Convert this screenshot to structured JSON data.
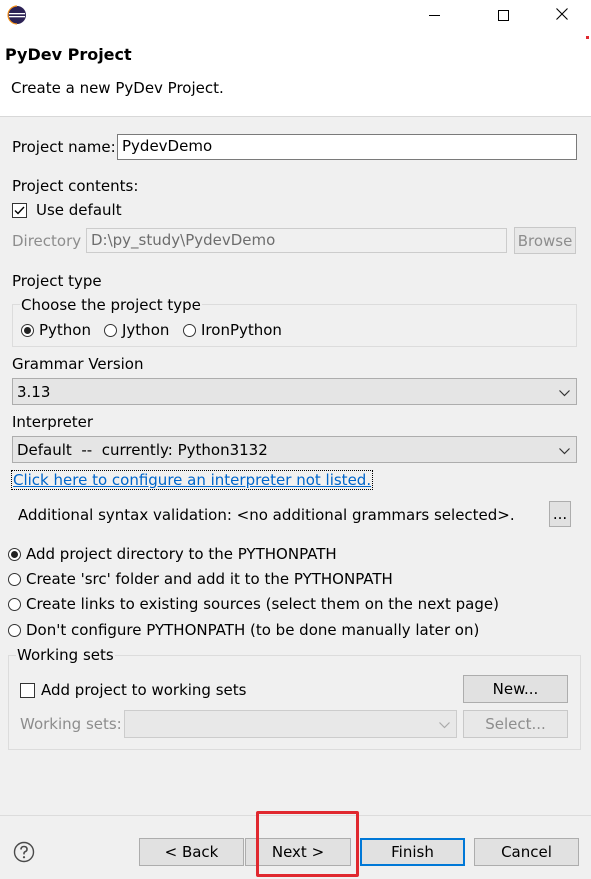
{
  "window": {
    "title": "",
    "icon": "eclipse-icon",
    "controls": [
      "minimize-icon",
      "maximize-icon",
      "close-icon"
    ]
  },
  "header": {
    "title": "PyDev Project",
    "description": "Create a new PyDev Project."
  },
  "project_name": {
    "label": "Project name:",
    "value": "PydevDemo"
  },
  "project_contents": {
    "label": "Project contents:",
    "use_default_label": "Use default",
    "use_default_checked": true,
    "directory_label": "Directory",
    "directory_value": "D:\\py_study\\PydevDemo",
    "browse_label": "Browse"
  },
  "project_type": {
    "label": "Project type",
    "group_label": "Choose the project type",
    "options": [
      "Python",
      "Jython",
      "IronPython"
    ],
    "selected": "Python"
  },
  "grammar": {
    "label": "Grammar Version",
    "value": "3.13"
  },
  "interpreter": {
    "label": "Interpreter",
    "value": "Default  --  currently: Python3132",
    "configure_link": "Click here to configure an interpreter not listed."
  },
  "syntax": {
    "label": "Additional syntax validation: <no additional grammars selected>.",
    "button_label": "..."
  },
  "pythonpath": {
    "options": [
      "Add project directory to the PYTHONPATH",
      "Create 'src' folder and add it to the PYTHONPATH",
      "Create links to existing sources (select them on the next page)",
      "Don't configure PYTHONPATH (to be done manually later on)"
    ],
    "selected_index": 0
  },
  "working_sets": {
    "group_label": "Working sets",
    "add_label": "Add project to working sets",
    "add_checked": false,
    "new_label": "New...",
    "sets_label": "Working sets:",
    "sets_value": "",
    "select_label": "Select..."
  },
  "footer": {
    "help_icon": "help-icon",
    "back_label": "< Back",
    "next_label": "Next >",
    "finish_label": "Finish",
    "cancel_label": "Cancel"
  },
  "colors": {
    "accent": "#0078d7",
    "highlight": "#e0282f",
    "link": "#0066cc"
  }
}
